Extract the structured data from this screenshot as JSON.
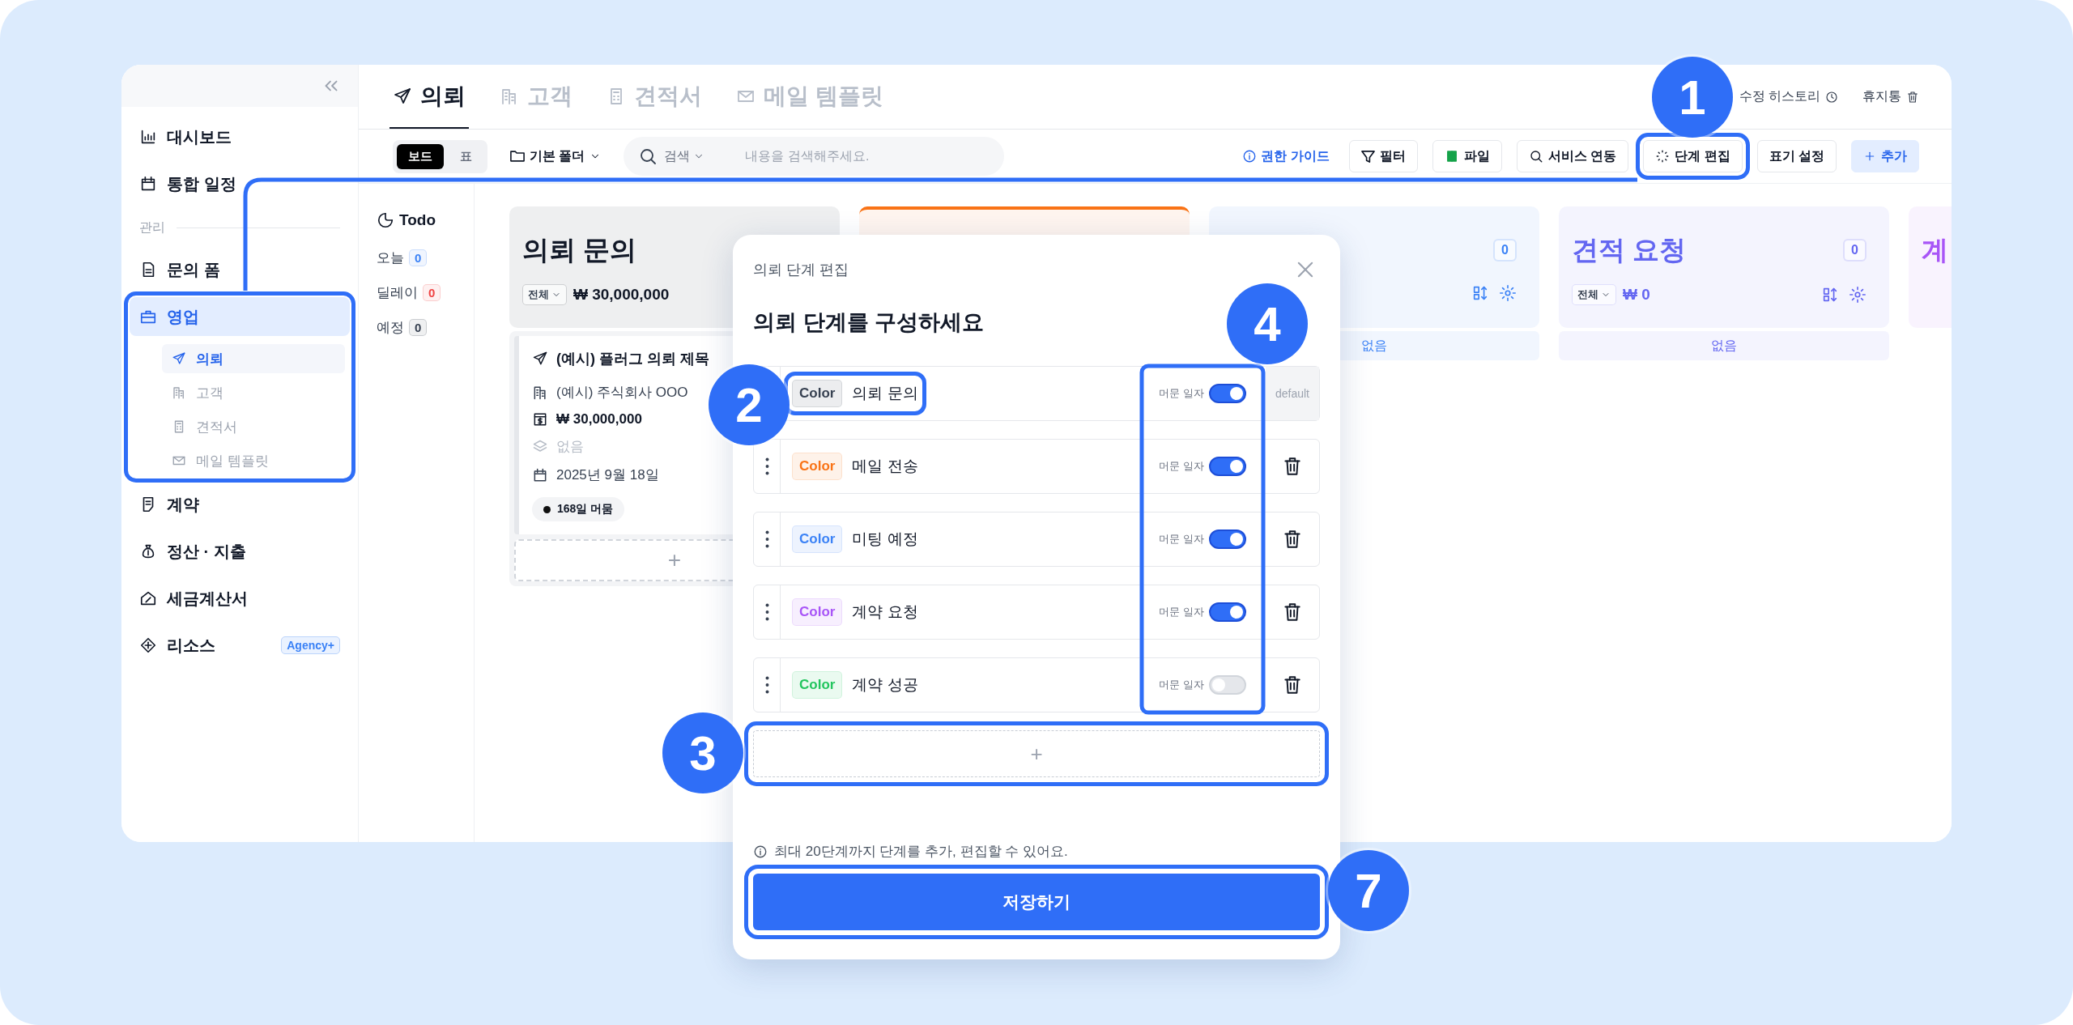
{
  "sidebar": {
    "items": [
      {
        "kind": "item",
        "label": "대시보드",
        "selected": false
      },
      {
        "kind": "item",
        "label": "통합 일정",
        "selected": false
      },
      {
        "kind": "section",
        "label": "관리"
      },
      {
        "kind": "item",
        "label": "문의 폼",
        "selected": false
      },
      {
        "kind": "item",
        "label": "영업",
        "selected": true,
        "children": [
          {
            "label": "의뢰",
            "selected": true
          },
          {
            "label": "고객",
            "selected": false
          },
          {
            "label": "견적서",
            "selected": false
          },
          {
            "label": "메일 템플릿",
            "selected": false
          }
        ]
      },
      {
        "kind": "item",
        "label": "계약",
        "selected": false
      },
      {
        "kind": "item",
        "label": "정산 · 지출",
        "selected": false
      },
      {
        "kind": "item",
        "label": "세금계산서",
        "selected": false
      },
      {
        "kind": "item",
        "label": "리소스",
        "selected": false,
        "badge": "Agency+"
      }
    ]
  },
  "tabs": [
    {
      "label": "의뢰",
      "selected": true
    },
    {
      "label": "고객",
      "selected": false
    },
    {
      "label": "견적서",
      "selected": false
    },
    {
      "label": "메일 템플릿",
      "selected": false
    }
  ],
  "header_links": [
    "수정 히스토리",
    "휴지통"
  ],
  "view_toggle": [
    {
      "label": "보드",
      "selected": true
    },
    {
      "label": "표",
      "selected": false
    }
  ],
  "folder": "기본 폴더",
  "search": {
    "scope": "검색",
    "placeholder": "내용을 검색해주세요."
  },
  "actions": [
    {
      "kind": "link",
      "label": "권한 가이드"
    },
    {
      "kind": "outline",
      "label": "필터"
    },
    {
      "kind": "outline",
      "label": "파일"
    },
    {
      "kind": "outline",
      "label": "서비스 연동"
    },
    {
      "kind": "outline",
      "label": "단계 편집"
    },
    {
      "kind": "outline",
      "label": "표기 설정"
    },
    {
      "kind": "primary",
      "label": "추가"
    }
  ],
  "todo": {
    "title": "Todo",
    "counters": [
      {
        "label": "오늘",
        "count": "0",
        "color": "#3b82f6"
      },
      {
        "label": "딜레이",
        "count": "0",
        "color": "#ef4444"
      },
      {
        "label": "예정",
        "count": "0",
        "color": "#374151"
      }
    ]
  },
  "columns": [
    {
      "color": "#111827",
      "title": "의뢰 문의",
      "filter": "전체",
      "amount": "₩ 30,000,000",
      "cards": [
        {
          "title": "(예시) 플러그 의뢰 제목",
          "company": "(예시) 주식회사 OOO",
          "amount": "₩ 30,000,000",
          "tag": "없음",
          "date": "2025년 9월 18일",
          "stay": "168일 머뭄"
        }
      ],
      "add": "+"
    },
    {
      "color": "#f97316"
    },
    {
      "color": "#3b82f6",
      "count": "0",
      "empty_label": "없음"
    },
    {
      "color": "#6366f1",
      "title": "견적 요청",
      "count": "0",
      "filter": "전체",
      "amount": "₩ 0",
      "empty_label": "없음"
    },
    {
      "color": "#a855f7",
      "title": "계"
    }
  ],
  "modal": {
    "title": "의뢰 단계 편집",
    "heading": "의뢰 단계를 구성하세요",
    "stages": [
      {
        "kind": "default",
        "chip": "Color",
        "color": "#374151",
        "name": "의뢰 문의",
        "stay_label": "머문 일자",
        "on": true,
        "default_label": "default"
      },
      {
        "kind": "custom",
        "chip": "Color",
        "color": "#f97316",
        "name": "메일 전송",
        "stay_label": "머문 일자",
        "on": true
      },
      {
        "kind": "custom",
        "chip": "Color",
        "color": "#3b82f6",
        "name": "미팅 예정",
        "stay_label": "머문 일자",
        "on": true
      },
      {
        "kind": "custom",
        "chip": "Color",
        "color": "#a855f7",
        "name": "계약 요청",
        "stay_label": "머문 일자",
        "on": true
      },
      {
        "kind": "custom",
        "chip": "Color",
        "color": "#22c55e",
        "name": "계약 성공",
        "stay_label": "머문 일자",
        "on": false
      }
    ],
    "add": "+",
    "note": "최대 20단계까지 단계를 추가, 편집할 수 있어요.",
    "save": "저장하기"
  },
  "annotations": [
    {
      "number": "1"
    },
    {
      "number": "2"
    },
    {
      "number": "3"
    },
    {
      "number": "4"
    },
    {
      "number": "7"
    }
  ]
}
